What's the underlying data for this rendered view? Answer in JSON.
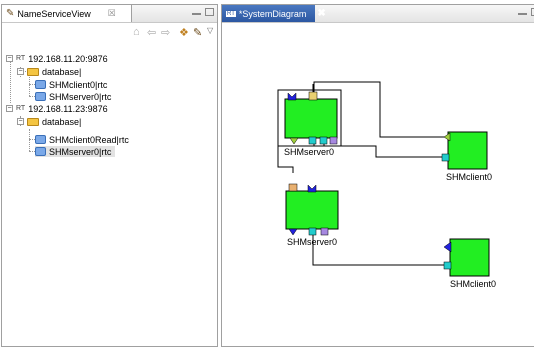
{
  "left_view": {
    "title": "NameServiceView",
    "close": "☒",
    "tree": {
      "server1": {
        "name": "192.168.11.20:9876",
        "rt": "RT",
        "folder": "database|",
        "components": [
          "SHMclient0|rtc",
          "SHMserver0|rtc"
        ]
      },
      "server2": {
        "name": "192.168.11.23:9876",
        "rt": "RT",
        "folder": "database|",
        "components": [
          "SHMclient0Read|rtc",
          "SHMserver0|rtc"
        ]
      }
    }
  },
  "right_view": {
    "title": "*SystemDiagram",
    "rt": "RT",
    "close": "✖"
  },
  "diagram": {
    "components": {
      "server_top": "SHMserver0",
      "client_top": "SHMclient0",
      "server_bottom": "SHMserver0",
      "client_bottom": "SHMclient0"
    },
    "component_color": "#22ee22"
  }
}
